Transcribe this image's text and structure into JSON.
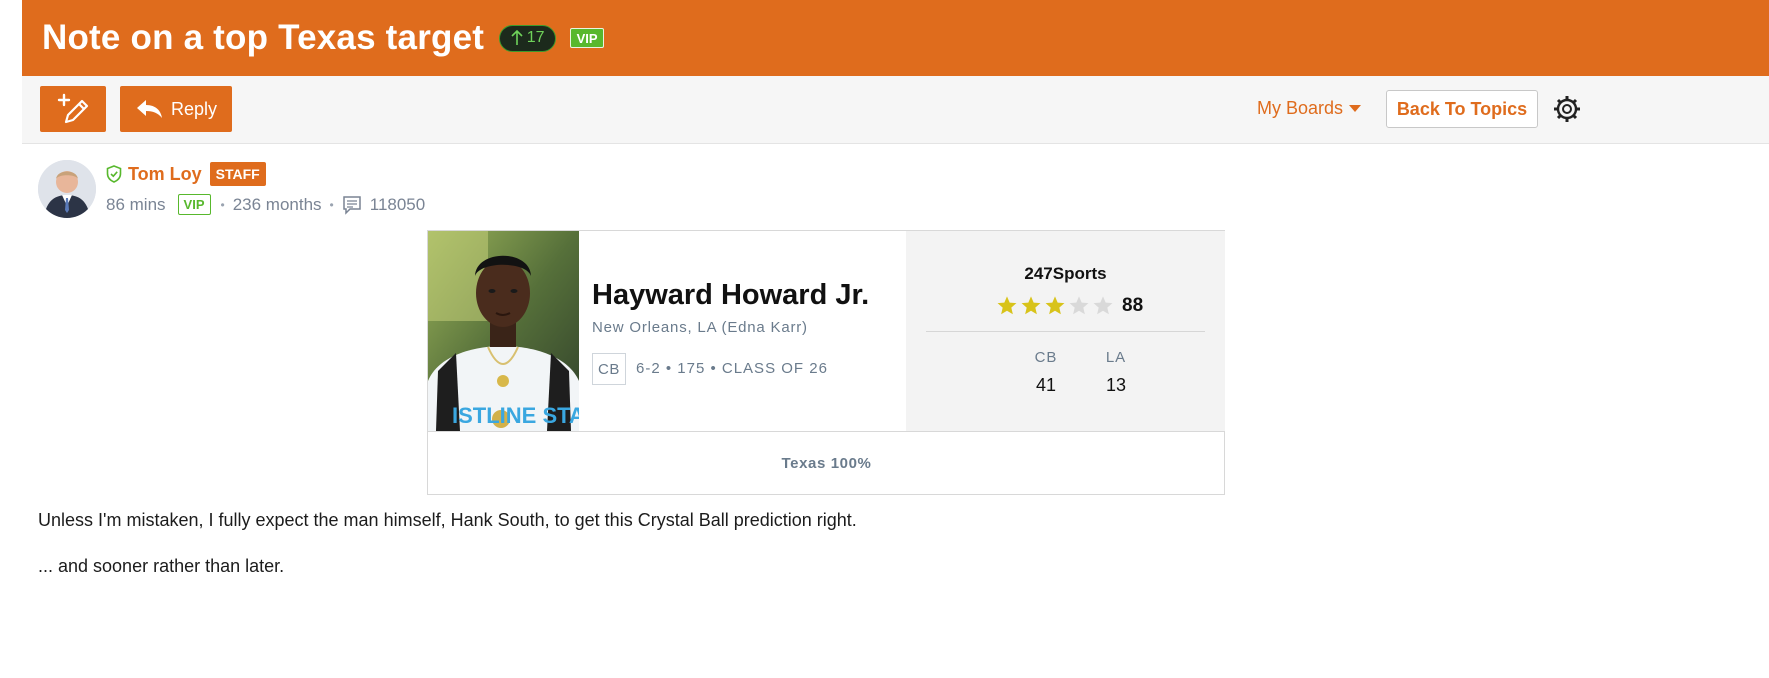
{
  "topic": {
    "title": "Note on a top Texas target",
    "upvotes": "17",
    "vip_label": "VIP"
  },
  "toolbar": {
    "reply_label": "Reply",
    "my_boards_label": "My Boards",
    "back_label": "Back To Topics"
  },
  "post": {
    "author": "Tom Loy",
    "staff_label": "STAFF",
    "time_ago": "86 mins",
    "vip_label": "VIP",
    "tenure": "236 months",
    "post_count": "118050",
    "body": [
      "Unless I'm mistaken, I fully expect the man himself, Hank South, to get this Crystal Ball prediction right.",
      "... and sooner rather than later."
    ]
  },
  "player_card": {
    "name": "Hayward Howard Jr.",
    "hometown": "New Orleans, LA (Edna Karr)",
    "position": "CB",
    "measurables": "6-2 • 175 • CLASS OF 26",
    "rating_source": "247Sports",
    "stars": 3,
    "max_stars": 5,
    "rating": "88",
    "ranks": [
      {
        "label": "CB",
        "value": "41"
      },
      {
        "label": "LA",
        "value": "13"
      }
    ],
    "prediction": "Texas 100%"
  },
  "colors": {
    "brand_orange": "#df6c1d",
    "vip_green": "#58b82d",
    "star_gold": "#d8c31a",
    "star_empty": "#d9d9d9"
  }
}
